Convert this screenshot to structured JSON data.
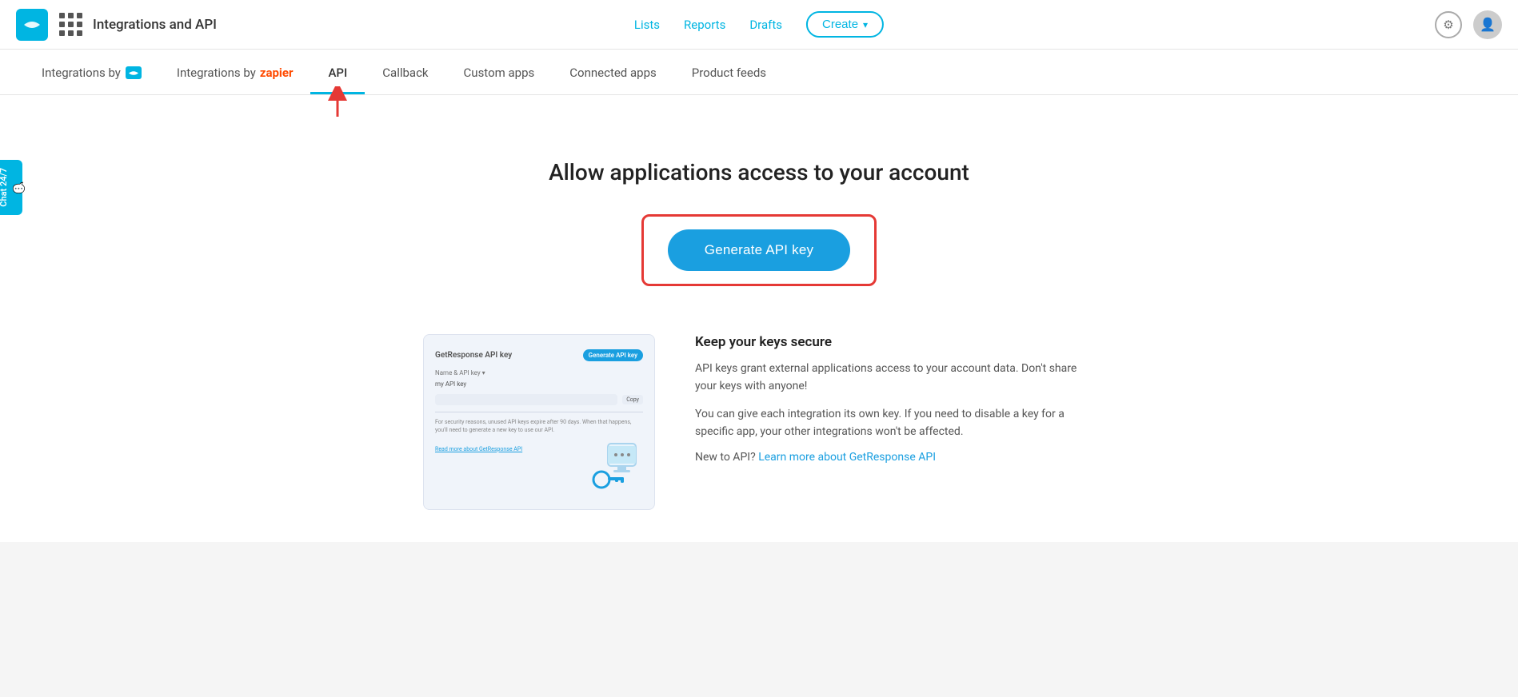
{
  "app": {
    "title": "Integrations and API"
  },
  "nav": {
    "links": [
      "Lists",
      "Reports",
      "Drafts"
    ],
    "create_label": "Create",
    "create_chevron": "▾"
  },
  "tabs": [
    {
      "id": "integrations-brevo",
      "label": "Integrations by",
      "has_logo": true
    },
    {
      "id": "integrations-zapier",
      "label": "Integrations by",
      "zapier": true
    },
    {
      "id": "api",
      "label": "API",
      "active": true
    },
    {
      "id": "callback",
      "label": "Callback"
    },
    {
      "id": "custom-apps",
      "label": "Custom apps"
    },
    {
      "id": "connected-apps",
      "label": "Connected apps"
    },
    {
      "id": "product-feeds",
      "label": "Product feeds"
    }
  ],
  "page": {
    "heading": "Allow applications access to your account",
    "generate_btn_label": "Generate API key"
  },
  "info": {
    "preview_title": "GetResponse API key",
    "preview_gen_btn": "Generate API key",
    "preview_label": "Name & API key ▾",
    "preview_key_name": "my API key",
    "preview_copy": "Copy",
    "preview_note": "For security reasons, unused API keys expire after 90 days. When that happens, you'll need to generate a new key to use our API.",
    "preview_read_link": "Read more about GetResponse API",
    "keys_title": "Keep your keys secure",
    "keys_text1": "API keys grant external applications access to your account data. Don't share your keys with anyone!",
    "keys_text2": "You can give each integration its own key. If you need to disable a key for a specific app, your other integrations won't be affected.",
    "keys_new_prefix": "New to API?",
    "keys_new_link": "Learn more about GetResponse API"
  },
  "chat": {
    "label": "Chat 24/7"
  }
}
